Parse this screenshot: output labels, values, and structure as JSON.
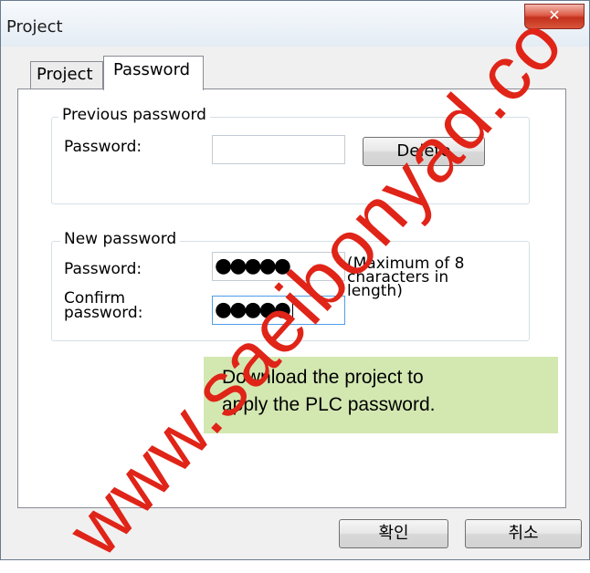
{
  "window": {
    "title": "Project",
    "close_glyph": "✕"
  },
  "tabs": [
    {
      "label": "Project",
      "selected": false
    },
    {
      "label": "Password",
      "selected": true
    }
  ],
  "previous_password": {
    "group_label": "Previous password",
    "password_label": "Password:",
    "password_value": "",
    "delete_label": "Delete"
  },
  "new_password": {
    "group_label": "New password",
    "password_label": "Password:",
    "password_value": "●●●●●",
    "confirm_label_line1": "Confirm",
    "confirm_label_line2": "password:",
    "confirm_value": "●●●●●",
    "hint_line1": "(Maximum of 8",
    "hint_line2": "characters in",
    "hint_line3": "length)"
  },
  "note": {
    "line1": "Download the project to",
    "line2": "apply the PLC password."
  },
  "buttons": {
    "ok_label": "확인",
    "cancel_label": "취소"
  },
  "watermark": {
    "text": "www.saeibonyad.co"
  },
  "colors": {
    "note_bg": "#d3e8b1",
    "watermark": "#e02418",
    "close_button": "#c3301c"
  }
}
